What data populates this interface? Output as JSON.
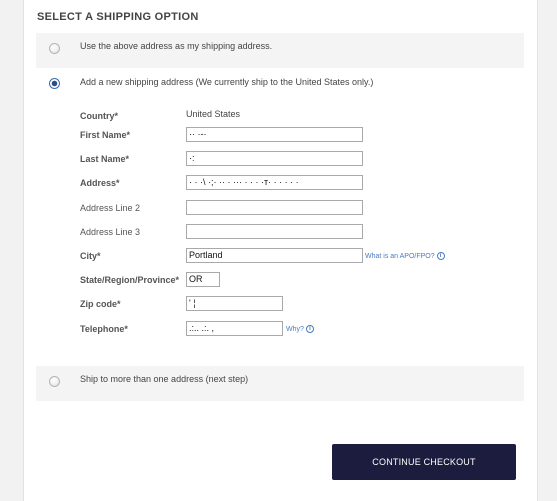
{
  "section_title": "SELECT A SHIPPING OPTION",
  "options": [
    {
      "label": "Use the above address as my shipping address.",
      "selected": false
    },
    {
      "label": "Add a new shipping address (We currently ship to the United States only.)",
      "selected": true
    },
    {
      "label": "Ship to more than one address (next step)",
      "selected": false
    }
  ],
  "form": {
    "country": {
      "label": "Country*",
      "value": "United States"
    },
    "first_name": {
      "label": "First Name*",
      "value": "·· ·-·"
    },
    "last_name": {
      "label": "Last Name*",
      "value": "  ·:"
    },
    "address": {
      "label": "Address*",
      "value": "·  ·  ·\\ ·;· ·· ·  ··· · · ·  ·ᴛ·  ·  ·  ·  · ·"
    },
    "address2": {
      "label": "Address Line 2",
      "value": ""
    },
    "address3": {
      "label": "Address Line 3",
      "value": ""
    },
    "city": {
      "label": "City*",
      "value": "Portland"
    },
    "state": {
      "label": "State/Region/Province*",
      "value": "OR"
    },
    "zip": {
      "label": "Zip code*",
      "value": "  ' ¦"
    },
    "telephone": {
      "label": "Telephone*",
      "value": ".:.. .:.   ,"
    }
  },
  "help_links": {
    "apo": "What is an APO/FPO?",
    "why": "Why?"
  },
  "icons": {
    "info": "info-icon",
    "radio": "radio-button"
  },
  "buttons": {
    "continue": "CONTINUE CHECKOUT"
  },
  "colors": {
    "button_bg": "#1c1d3e",
    "link": "#4a7bbf",
    "radio_selected": "#2a4f86"
  }
}
